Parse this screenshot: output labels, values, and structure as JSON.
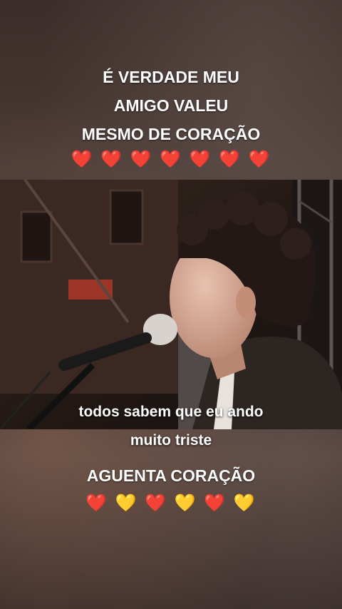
{
  "caption_top": {
    "line1": "É VERDADE MEU",
    "line2": "AMIGO VALEU",
    "line3": "MESMO DE CORAÇÃO",
    "hearts": [
      "❤️",
      "❤️",
      "❤️",
      "❤️",
      "❤️",
      "❤️",
      "❤️"
    ]
  },
  "video": {
    "subtitle_line1": "todos sabem que eu ando",
    "subtitle_line2": "muito triste"
  },
  "caption_bottom": {
    "title": "AGUENTA CORAÇÃO",
    "hearts": [
      "❤️",
      "💛",
      "❤️",
      "💛",
      "❤️",
      "💛"
    ]
  },
  "colors": {
    "heart_red": "#e5232f",
    "heart_yellow": "#f5c518",
    "text": "#ffffff"
  }
}
